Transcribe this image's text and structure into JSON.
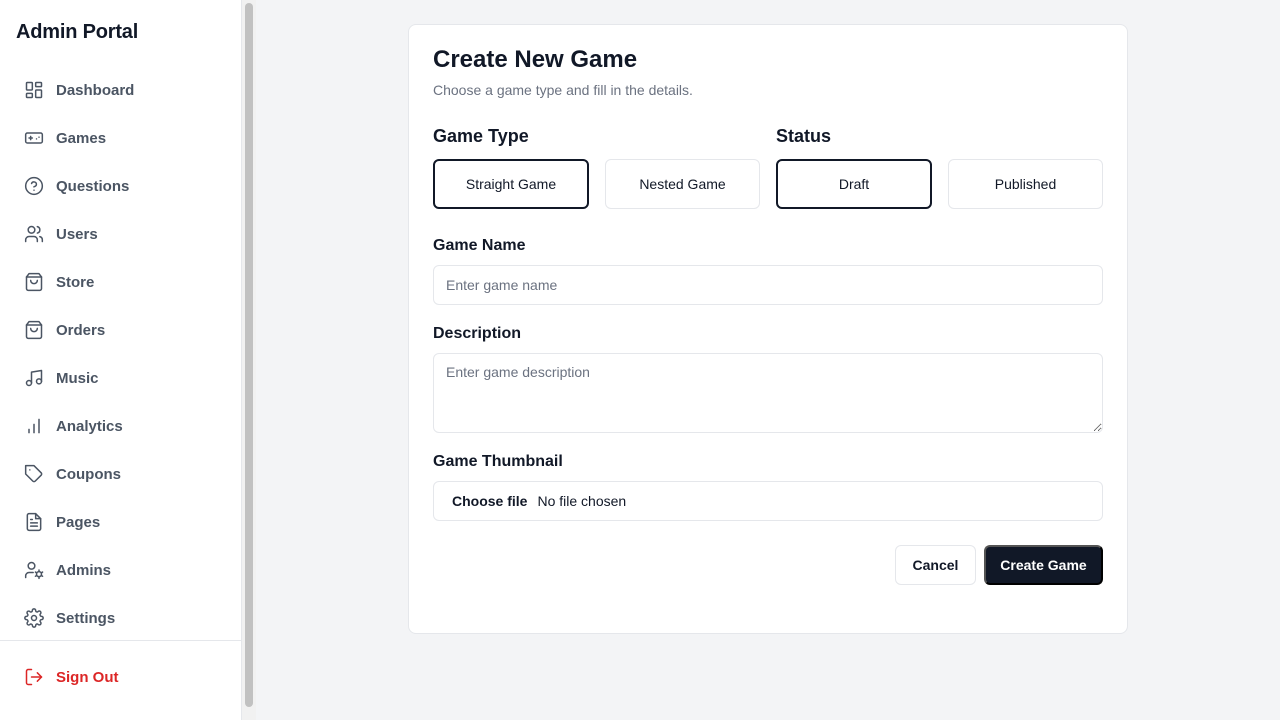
{
  "sidebar": {
    "brand": "Admin Portal",
    "items": [
      {
        "label": "Dashboard",
        "icon": "dashboard-icon"
      },
      {
        "label": "Games",
        "icon": "gamepad-icon"
      },
      {
        "label": "Questions",
        "icon": "help-circle-icon"
      },
      {
        "label": "Users",
        "icon": "users-icon"
      },
      {
        "label": "Store",
        "icon": "shopping-bag-icon"
      },
      {
        "label": "Orders",
        "icon": "shopping-bag-icon"
      },
      {
        "label": "Music",
        "icon": "music-icon"
      },
      {
        "label": "Analytics",
        "icon": "bar-chart-icon"
      },
      {
        "label": "Coupons",
        "icon": "tag-icon"
      },
      {
        "label": "Pages",
        "icon": "file-text-icon"
      },
      {
        "label": "Admins",
        "icon": "user-cog-icon"
      },
      {
        "label": "Settings",
        "icon": "gear-icon"
      }
    ],
    "signout": {
      "label": "Sign Out",
      "icon": "logout-icon"
    }
  },
  "form": {
    "title": "Create New Game",
    "subtitle": "Choose a game type and fill in the details.",
    "game_type": {
      "label": "Game Type",
      "options": [
        "Straight Game",
        "Nested Game"
      ],
      "selected": "Straight Game"
    },
    "status": {
      "label": "Status",
      "options": [
        "Draft",
        "Published"
      ],
      "selected": "Draft"
    },
    "game_name": {
      "label": "Game Name",
      "placeholder": "Enter game name",
      "value": ""
    },
    "description": {
      "label": "Description",
      "placeholder": "Enter game description",
      "value": ""
    },
    "thumbnail": {
      "label": "Game Thumbnail",
      "button": "Choose file",
      "status": "No file chosen"
    },
    "cancel_label": "Cancel",
    "submit_label": "Create Game"
  },
  "colors": {
    "primary": "#111827",
    "danger": "#dc2626",
    "muted": "#6b7280",
    "border": "#e5e7eb",
    "background": "#f3f4f6"
  }
}
